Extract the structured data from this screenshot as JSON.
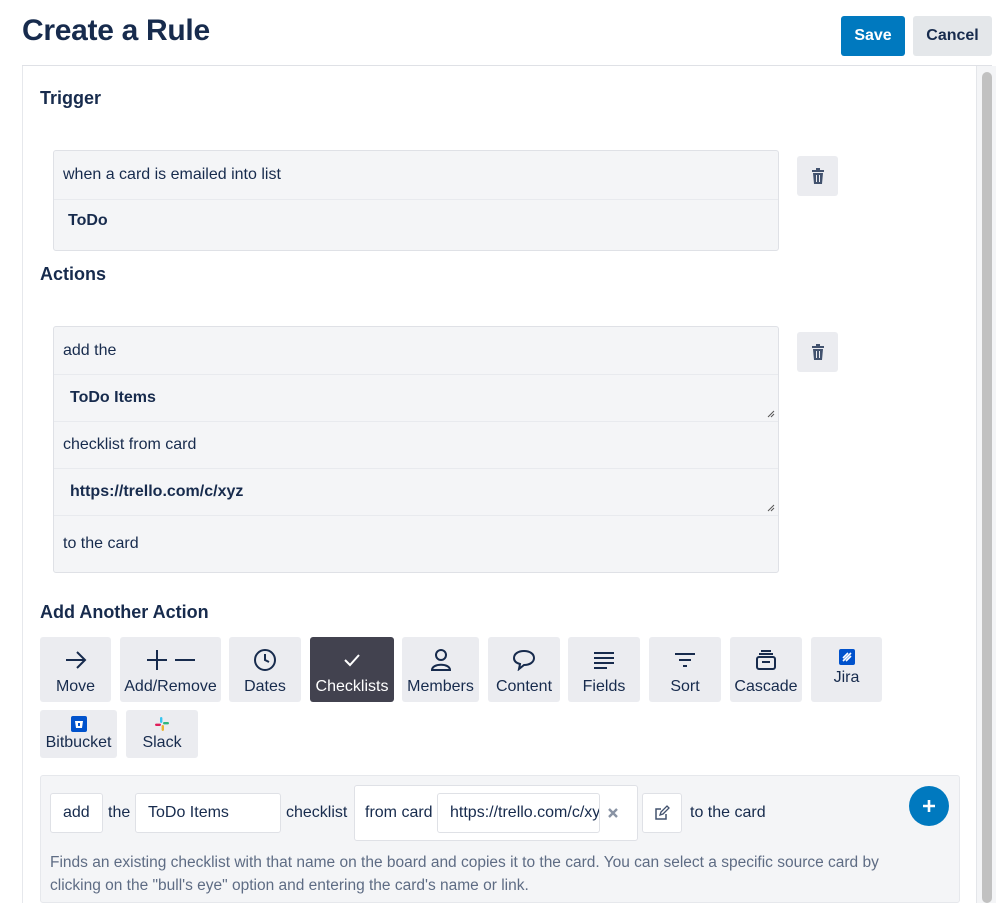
{
  "header": {
    "title": "Create a Rule",
    "save_label": "Save",
    "cancel_label": "Cancel"
  },
  "trigger": {
    "section_title": "Trigger",
    "rows": [
      "when a card is emailed into list",
      "ToDo"
    ]
  },
  "actions": {
    "section_title": "Actions",
    "rows": [
      "add the",
      "ToDo Items",
      "checklist from card",
      "https://trello.com/c/xyz",
      "to the card"
    ]
  },
  "add_another": {
    "section_title": "Add Another Action",
    "tiles": [
      {
        "label": "Move",
        "icon": "arrow-right-icon"
      },
      {
        "label": "Add/Remove",
        "icon": "plus-minus-icon"
      },
      {
        "label": "Dates",
        "icon": "clock-icon"
      },
      {
        "label": "Checklists",
        "icon": "check-icon",
        "active": true
      },
      {
        "label": "Members",
        "icon": "person-icon"
      },
      {
        "label": "Content",
        "icon": "speech-bubble-icon"
      },
      {
        "label": "Fields",
        "icon": "lines-icon"
      },
      {
        "label": "Sort",
        "icon": "sort-icon"
      },
      {
        "label": "Cascade",
        "icon": "cascade-icon"
      },
      {
        "label": "Jira",
        "icon": "jira-icon"
      },
      {
        "label": "Bitbucket",
        "icon": "bitbucket-icon"
      },
      {
        "label": "Slack",
        "icon": "slack-icon"
      }
    ]
  },
  "builder": {
    "verb_value": "add",
    "the_label": "the",
    "checklist_name": "ToDo Items",
    "checklist_label": "checklist",
    "from_card_label": "from card",
    "card_url": "https://trello.com/c/xyz",
    "to_card_label": "to the card",
    "description": "Finds an existing checklist with that name on the board and copies it to the card. You can select a specific source card by clicking on the \"bull's eye\" option and entering the card's name or link."
  },
  "colors": {
    "primary": "#0079bf",
    "text": "#172b4d",
    "tile_bg": "#ebecf0",
    "tile_active": "#42424f"
  }
}
